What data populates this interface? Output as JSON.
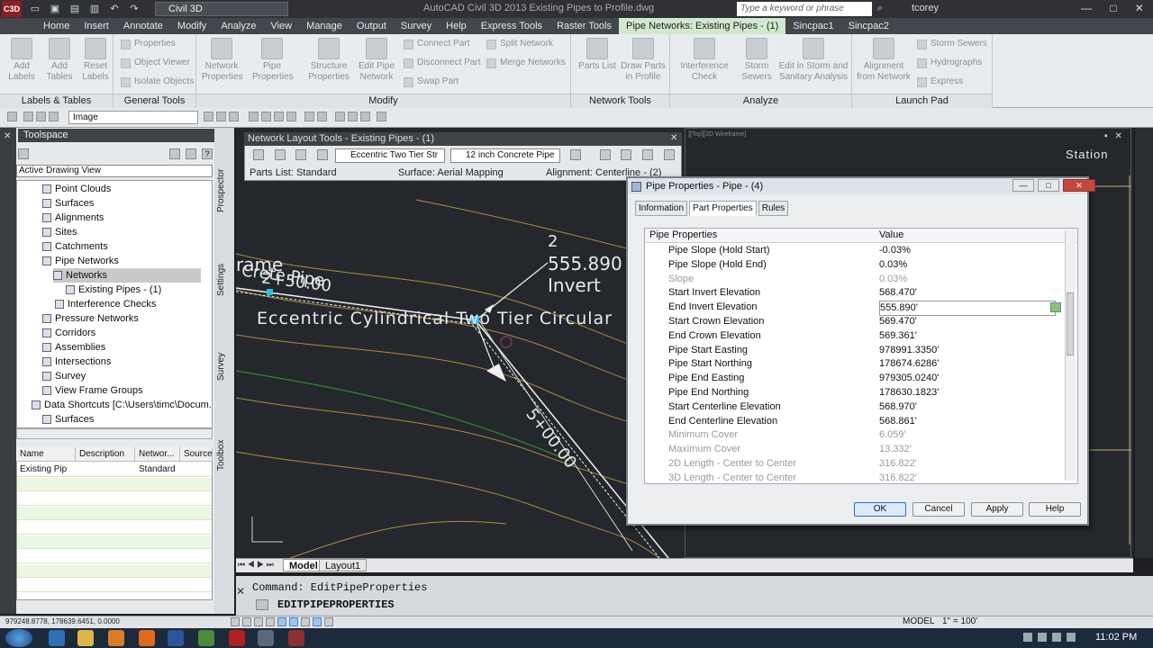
{
  "titlebar": {
    "workspace": "Civil 3D",
    "app_title": "AutoCAD Civil 3D 2013    Existing Pipes to Profile.dwg",
    "search_placeholder": "Type a keyword or phrase",
    "user": "tcorey"
  },
  "ribbon_tabs": [
    "Home",
    "Insert",
    "Annotate",
    "Modify",
    "Analyze",
    "View",
    "Manage",
    "Output",
    "Survey",
    "Help",
    "Express Tools",
    "Raster Tools",
    "Pipe Networks: Existing Pipes - (1)",
    "Sincpac1",
    "Sincpac2"
  ],
  "ribbon": {
    "labels_tables": {
      "title": "Labels & Tables",
      "add_labels": "Add Labels",
      "add_tables": "Add Tables",
      "reset_labels": "Reset Labels"
    },
    "general_tools": {
      "title": "General Tools",
      "properties": "Properties",
      "object_viewer": "Object Viewer",
      "isolate_objects": "Isolate Objects"
    },
    "modify": {
      "title": "Modify",
      "network_properties": "Network Properties",
      "pipe_properties": "Pipe Properties",
      "structure_properties": "Structure Properties",
      "edit_pipe_network": "Edit Pipe Network",
      "connect_part": "Connect Part",
      "disconnect_part": "Disconnect Part",
      "swap_part": "Swap Part",
      "split_network": "Split Network",
      "merge_networks": "Merge Networks"
    },
    "network_tools": {
      "title": "Network Tools",
      "parts_list": "Parts List",
      "draw_parts_in_profile": "Draw Parts in Profile"
    },
    "analyze": {
      "title": "Analyze",
      "interference_check": "Interference Check",
      "storm_sewers": "Storm Sewers",
      "edit_storm_sanitary": "Edit in Storm and Sanitary Analysis"
    },
    "launch_pad": {
      "title": "Launch Pad",
      "alignment_from_network": "Alignment from Network",
      "storm_sewers": "Storm Sewers",
      "hydrographs": "Hydrographs",
      "express": "Express"
    }
  },
  "toolbar": {
    "layer": "Image"
  },
  "toolspace": {
    "title": "Toolspace",
    "view": "Active Drawing View",
    "tree": [
      {
        "label": "Point Clouds",
        "indent": 1
      },
      {
        "label": "Surfaces",
        "indent": 1
      },
      {
        "label": "Alignments",
        "indent": 1
      },
      {
        "label": "Sites",
        "indent": 1
      },
      {
        "label": "Catchments",
        "indent": 1
      },
      {
        "label": "Pipe Networks",
        "indent": 1
      },
      {
        "label": "Networks",
        "indent": 2
      },
      {
        "label": "Existing Pipes - (1)",
        "indent": 3
      },
      {
        "label": "Interference Checks",
        "indent": 2
      },
      {
        "label": "Pressure Networks",
        "indent": 1
      },
      {
        "label": "Corridors",
        "indent": 1
      },
      {
        "label": "Assemblies",
        "indent": 1
      },
      {
        "label": "Intersections",
        "indent": 1
      },
      {
        "label": "Survey",
        "indent": 1
      },
      {
        "label": "View Frame Groups",
        "indent": 1
      },
      {
        "label": "Data Shortcuts [C:\\Users\\timc\\Docum...",
        "indent": 0
      },
      {
        "label": "Surfaces",
        "indent": 1
      }
    ],
    "side_tabs": [
      "Prospector",
      "Settings",
      "Survey",
      "Toolbox"
    ],
    "list_columns": [
      "Name",
      "Description",
      "Networ...",
      "Source"
    ],
    "list_rows": [
      [
        "Existing Pip",
        "",
        "Standard",
        ""
      ]
    ]
  },
  "network_layout_tools": {
    "title": "Network Layout Tools - Existing Pipes - (1)",
    "structure": "Eccentric Two Tier Str",
    "pipe": "12 inch Concrete Pipe",
    "parts_list": "Parts List: Standard",
    "surface": "Surface: Aerial Mapping",
    "alignment": "Alignment: Centerline - (2)"
  },
  "drawing": {
    "label_2": "2",
    "label_invert_value": "555.890",
    "label_invert": "Invert",
    "label_frame": "rame",
    "label_cte_pipe": "Crete Pipe",
    "label_station": "2+50.00",
    "label_eccentric": "Eccentric Cylindrical Two Tier Circular",
    "label_station2": "5+00.00",
    "viewport2_label": "Station",
    "viewport2_caption": "][Top][2D Wireframe]"
  },
  "dialog": {
    "title": "Pipe Properties - Pipe - (4)",
    "tabs": [
      "Information",
      "Part Properties",
      "Rules"
    ],
    "header_name": "Pipe Properties",
    "header_value": "Value",
    "rows": [
      {
        "name": "Pipe Slope (Hold Start)",
        "value": "-0.03%",
        "ro": false
      },
      {
        "name": "Pipe Slope (Hold End)",
        "value": "0.03%",
        "ro": false
      },
      {
        "name": "Slope",
        "value": "0.03%",
        "ro": true
      },
      {
        "name": "Start Invert Elevation",
        "value": "568.470'",
        "ro": false
      },
      {
        "name": "End Invert Elevation",
        "value": "555.890'",
        "ro": false,
        "sel": true
      },
      {
        "name": "Start Crown Elevation",
        "value": "569.470'",
        "ro": false
      },
      {
        "name": "End Crown Elevation",
        "value": "569.361'",
        "ro": false
      },
      {
        "name": "Pipe Start Easting",
        "value": "978991.3350'",
        "ro": false
      },
      {
        "name": "Pipe Start Northing",
        "value": "178674.6286'",
        "ro": false
      },
      {
        "name": "Pipe End Easting",
        "value": "979305.0240'",
        "ro": false
      },
      {
        "name": "Pipe End Northing",
        "value": "178630.1823'",
        "ro": false
      },
      {
        "name": "Start Centerline Elevation",
        "value": "568.970'",
        "ro": false
      },
      {
        "name": "End Centerline Elevation",
        "value": "568.861'",
        "ro": false
      },
      {
        "name": "Minimum Cover",
        "value": "6.059'",
        "ro": true
      },
      {
        "name": "Maximum Cover",
        "value": "13.332'",
        "ro": true
      },
      {
        "name": "2D Length - Center to Center",
        "value": "316.822'",
        "ro": true
      },
      {
        "name": "3D Length - Center to Center",
        "value": "316.822'",
        "ro": true
      }
    ],
    "buttons": {
      "ok": "OK",
      "cancel": "Cancel",
      "apply": "Apply",
      "help": "Help"
    }
  },
  "layout_tabs": [
    "Model",
    "Layout1"
  ],
  "command": {
    "history": "Command: EditPipeProperties",
    "current": "EDITPIPEPROPERTIES"
  },
  "status": {
    "coords": "979248.8778, 178639.6451, 0.0000",
    "model": "MODEL",
    "scale": "1\" = 100'"
  },
  "taskbar": {
    "clock": "11:02 PM"
  },
  "colors": {
    "drawing_bg": "#24282d",
    "contour": "#b08a3a",
    "ribbon_active_tab": "#cfe8cf",
    "accent": "#2a6fc9"
  }
}
